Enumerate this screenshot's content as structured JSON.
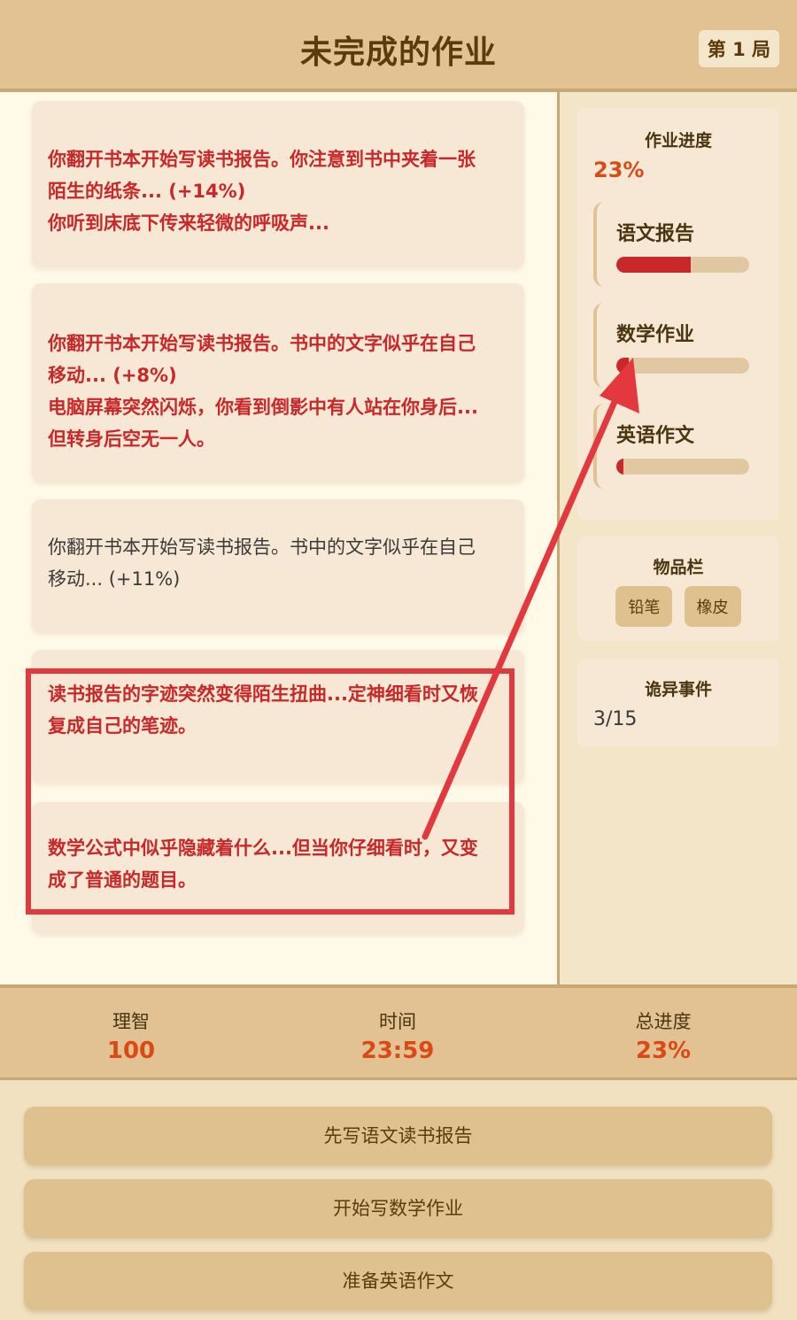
{
  "header": {
    "title": "未完成的作业",
    "round": "第 1 局"
  },
  "log": {
    "messages": [
      {
        "style": "red",
        "lines": [
          "你翻开书本开始写读书报告。你注意到书中夹着一张",
          "陌生的纸条... (+14%)",
          "你听到床底下传来轻微的呼吸声..."
        ]
      },
      {
        "style": "red",
        "lines": [
          "你翻开书本开始写读书报告。书中的文字似乎在自己",
          "移动... (+8%)",
          "电脑屏幕突然闪烁，你看到倒影中有人站在你身后...",
          "但转身后空无一人。"
        ]
      },
      {
        "style": "gray",
        "lines": [
          "你翻开书本开始写读书报告。书中的文字似乎在自己",
          "移动... (+11%)"
        ]
      },
      {
        "style": "red",
        "lines": [
          "读书报告的字迹突然变得陌生扭曲...定神细看时又恢",
          "复成自己的笔迹。"
        ]
      },
      {
        "style": "red",
        "lines": [
          "数学公式中似乎隐藏着什么...但当你仔细看时，又变",
          "成了普通的题目。"
        ]
      }
    ]
  },
  "sidebar": {
    "progress": {
      "title": "作业进度",
      "percent": "23%",
      "subjects": [
        {
          "label": "语文报告",
          "fill": 0.56
        },
        {
          "label": "数学作业",
          "fill": 0.09
        },
        {
          "label": "英语作文",
          "fill": 0.05
        }
      ]
    },
    "inventory": {
      "title": "物品栏",
      "items": [
        "铅笔",
        "橡皮"
      ]
    },
    "events": {
      "title": "诡异事件",
      "count": "3/15"
    }
  },
  "stats": {
    "sanity": {
      "label": "理智",
      "value": "100"
    },
    "time": {
      "label": "时间",
      "value": "23:59"
    },
    "total": {
      "label": "总进度",
      "value": "23%"
    }
  },
  "actions": [
    {
      "label": "先写语文读书报告"
    },
    {
      "label": "开始写数学作业"
    },
    {
      "label": "准备英语作文"
    }
  ],
  "colors": {
    "accent_red": "#c8282a",
    "value_orange": "#d94a16",
    "annotation_red": "#e2383e",
    "header_bg": "#e2c193"
  }
}
